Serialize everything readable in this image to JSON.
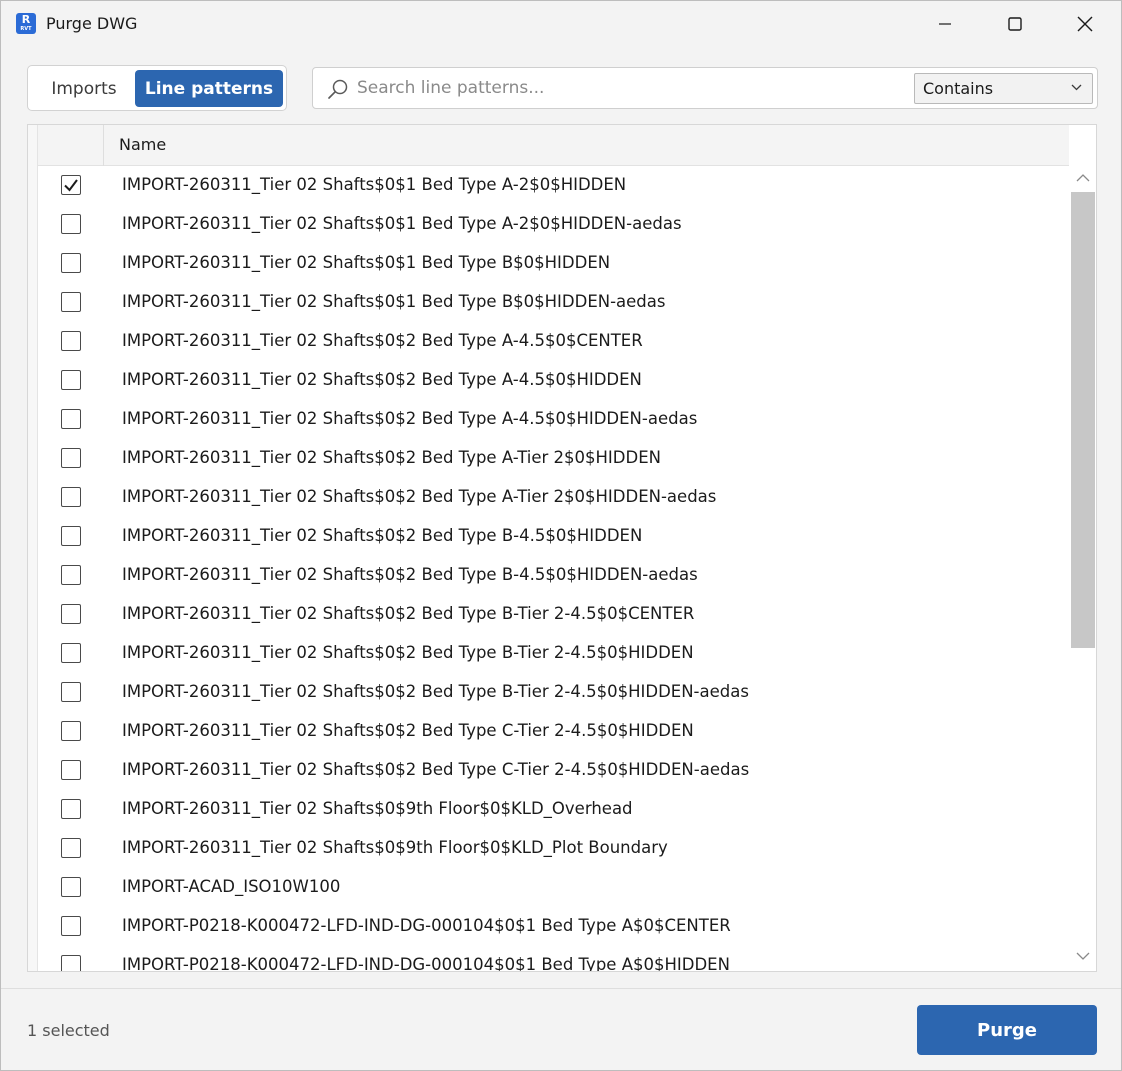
{
  "window": {
    "title": "Purge DWG",
    "app_icon": {
      "letter": "R",
      "caption": "RVT",
      "color": "#2b6bd6"
    }
  },
  "toolbar": {
    "tabs": [
      {
        "label": "Imports",
        "active": false
      },
      {
        "label": "Line patterns",
        "active": true
      }
    ],
    "search": {
      "placeholder": "Search line patterns...",
      "value": ""
    },
    "match_mode": {
      "selected": "Contains"
    }
  },
  "grid": {
    "columns": [
      "Name"
    ],
    "rows": [
      {
        "checked": true,
        "name": "IMPORT-260311_Tier 02 Shafts$0$1 Bed Type A-2$0$HIDDEN"
      },
      {
        "checked": false,
        "name": "IMPORT-260311_Tier 02 Shafts$0$1 Bed Type A-2$0$HIDDEN-aedas"
      },
      {
        "checked": false,
        "name": "IMPORT-260311_Tier 02 Shafts$0$1 Bed Type B$0$HIDDEN"
      },
      {
        "checked": false,
        "name": "IMPORT-260311_Tier 02 Shafts$0$1 Bed Type B$0$HIDDEN-aedas"
      },
      {
        "checked": false,
        "name": "IMPORT-260311_Tier 02 Shafts$0$2 Bed Type A-4.5$0$CENTER"
      },
      {
        "checked": false,
        "name": "IMPORT-260311_Tier 02 Shafts$0$2 Bed Type A-4.5$0$HIDDEN"
      },
      {
        "checked": false,
        "name": "IMPORT-260311_Tier 02 Shafts$0$2 Bed Type A-4.5$0$HIDDEN-aedas"
      },
      {
        "checked": false,
        "name": "IMPORT-260311_Tier 02 Shafts$0$2 Bed Type A-Tier 2$0$HIDDEN"
      },
      {
        "checked": false,
        "name": "IMPORT-260311_Tier 02 Shafts$0$2 Bed Type A-Tier 2$0$HIDDEN-aedas"
      },
      {
        "checked": false,
        "name": "IMPORT-260311_Tier 02 Shafts$0$2 Bed Type B-4.5$0$HIDDEN"
      },
      {
        "checked": false,
        "name": "IMPORT-260311_Tier 02 Shafts$0$2 Bed Type B-4.5$0$HIDDEN-aedas"
      },
      {
        "checked": false,
        "name": "IMPORT-260311_Tier 02 Shafts$0$2 Bed Type B-Tier 2-4.5$0$CENTER"
      },
      {
        "checked": false,
        "name": "IMPORT-260311_Tier 02 Shafts$0$2 Bed Type B-Tier 2-4.5$0$HIDDEN"
      },
      {
        "checked": false,
        "name": "IMPORT-260311_Tier 02 Shafts$0$2 Bed Type B-Tier 2-4.5$0$HIDDEN-aedas"
      },
      {
        "checked": false,
        "name": "IMPORT-260311_Tier 02 Shafts$0$2 Bed Type C-Tier 2-4.5$0$HIDDEN"
      },
      {
        "checked": false,
        "name": "IMPORT-260311_Tier 02 Shafts$0$2 Bed Type C-Tier 2-4.5$0$HIDDEN-aedas"
      },
      {
        "checked": false,
        "name": "IMPORT-260311_Tier 02 Shafts$0$9th Floor$0$KLD_Overhead"
      },
      {
        "checked": false,
        "name": "IMPORT-260311_Tier 02 Shafts$0$9th Floor$0$KLD_Plot Boundary"
      },
      {
        "checked": false,
        "name": "IMPORT-ACAD_ISO10W100"
      },
      {
        "checked": false,
        "name": "IMPORT-P0218-K000472-LFD-IND-DG-000104$0$1 Bed Type A$0$CENTER"
      },
      {
        "checked": false,
        "name": "IMPORT-P0218-K000472-LFD-IND-DG-000104$0$1 Bed Type A$0$HIDDEN"
      }
    ]
  },
  "footer": {
    "status": "1 selected",
    "purge_label": "Purge"
  },
  "colors": {
    "accent": "#2c66b0",
    "window_bg": "#f3f3f3",
    "scroll_thumb": "#c7c7c7"
  },
  "icons": [
    "revit-app-icon",
    "minimize-icon",
    "maximize-icon",
    "close-icon",
    "search-icon",
    "chevron-down-icon",
    "checkmark-icon",
    "scroll-up-icon",
    "scroll-down-icon"
  ]
}
